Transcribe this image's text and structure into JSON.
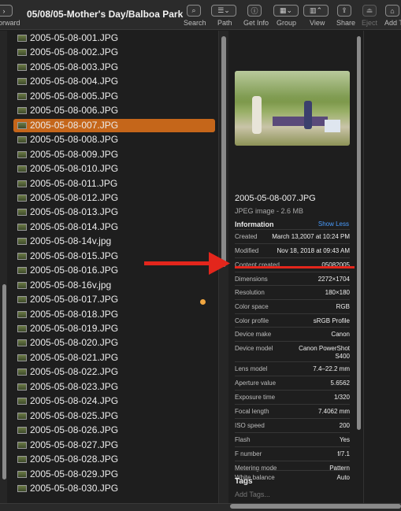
{
  "toolbar": {
    "forward_label": "orward",
    "title": "05/08/05-Mother's Day/Balboa Park",
    "search": "Search",
    "path": "Path",
    "get_info": "Get Info",
    "group": "Group",
    "view": "View",
    "share": "Share",
    "eject": "Eject",
    "add_tags": "Add T"
  },
  "files": [
    "2005-05-08-001.JPG",
    "2005-05-08-002.JPG",
    "2005-05-08-003.JPG",
    "2005-05-08-004.JPG",
    "2005-05-08-005.JPG",
    "2005-05-08-006.JPG",
    "2005-05-08-007.JPG",
    "2005-05-08-008.JPG",
    "2005-05-08-009.JPG",
    "2005-05-08-010.JPG",
    "2005-05-08-011.JPG",
    "2005-05-08-012.JPG",
    "2005-05-08-013.JPG",
    "2005-05-08-014.JPG",
    "2005-05-08-14v.jpg",
    "2005-05-08-015.JPG",
    "2005-05-08-016.JPG",
    "2005-05-08-16v.jpg",
    "2005-05-08-017.JPG",
    "2005-05-08-018.JPG",
    "2005-05-08-019.JPG",
    "2005-05-08-020.JPG",
    "2005-05-08-021.JPG",
    "2005-05-08-022.JPG",
    "2005-05-08-023.JPG",
    "2005-05-08-024.JPG",
    "2005-05-08-025.JPG",
    "2005-05-08-026.JPG",
    "2005-05-08-027.JPG",
    "2005-05-08-028.JPG",
    "2005-05-08-029.JPG",
    "2005-05-08-030.JPG"
  ],
  "selected_index": 6,
  "accent_color": "#c5661a",
  "tag_color": "#f0a640",
  "preview": {
    "name": "2005-05-08-007.JPG",
    "kind": "JPEG image - 2.6 MB",
    "info_heading": "Information",
    "show_less": "Show Less",
    "info": [
      {
        "k": "Created",
        "v": "March 13,2007 at 10:24 PM"
      },
      {
        "k": "Modified",
        "v": "Nov 18, 2018 at 09:43 AM"
      },
      {
        "k": "Content created",
        "v": "05082005"
      },
      {
        "k": "Dimensions",
        "v": "2272×1704"
      },
      {
        "k": "Resolution",
        "v": "180×180"
      },
      {
        "k": "Color space",
        "v": "RGB"
      },
      {
        "k": "Color profile",
        "v": "sRGB Profile"
      },
      {
        "k": "Device make",
        "v": "Canon"
      },
      {
        "k": "Device model",
        "v": "Canon PowerShot S400"
      },
      {
        "k": "Lens model",
        "v": "7.4–22.2 mm"
      },
      {
        "k": "Aperture value",
        "v": "5.6562"
      },
      {
        "k": "Exposure time",
        "v": "1/320"
      },
      {
        "k": "Focal length",
        "v": "7.4062 mm"
      },
      {
        "k": "ISO speed",
        "v": "200"
      },
      {
        "k": "Flash",
        "v": "Yes"
      },
      {
        "k": "F number",
        "v": "f/7.1"
      },
      {
        "k": "Metering mode",
        "v": "Pattern"
      },
      {
        "k": "White balance",
        "v": "Auto"
      }
    ],
    "tags_heading": "Tags",
    "add_tags_placeholder": "Add Tags..."
  },
  "annotation_color": "#e3261c"
}
